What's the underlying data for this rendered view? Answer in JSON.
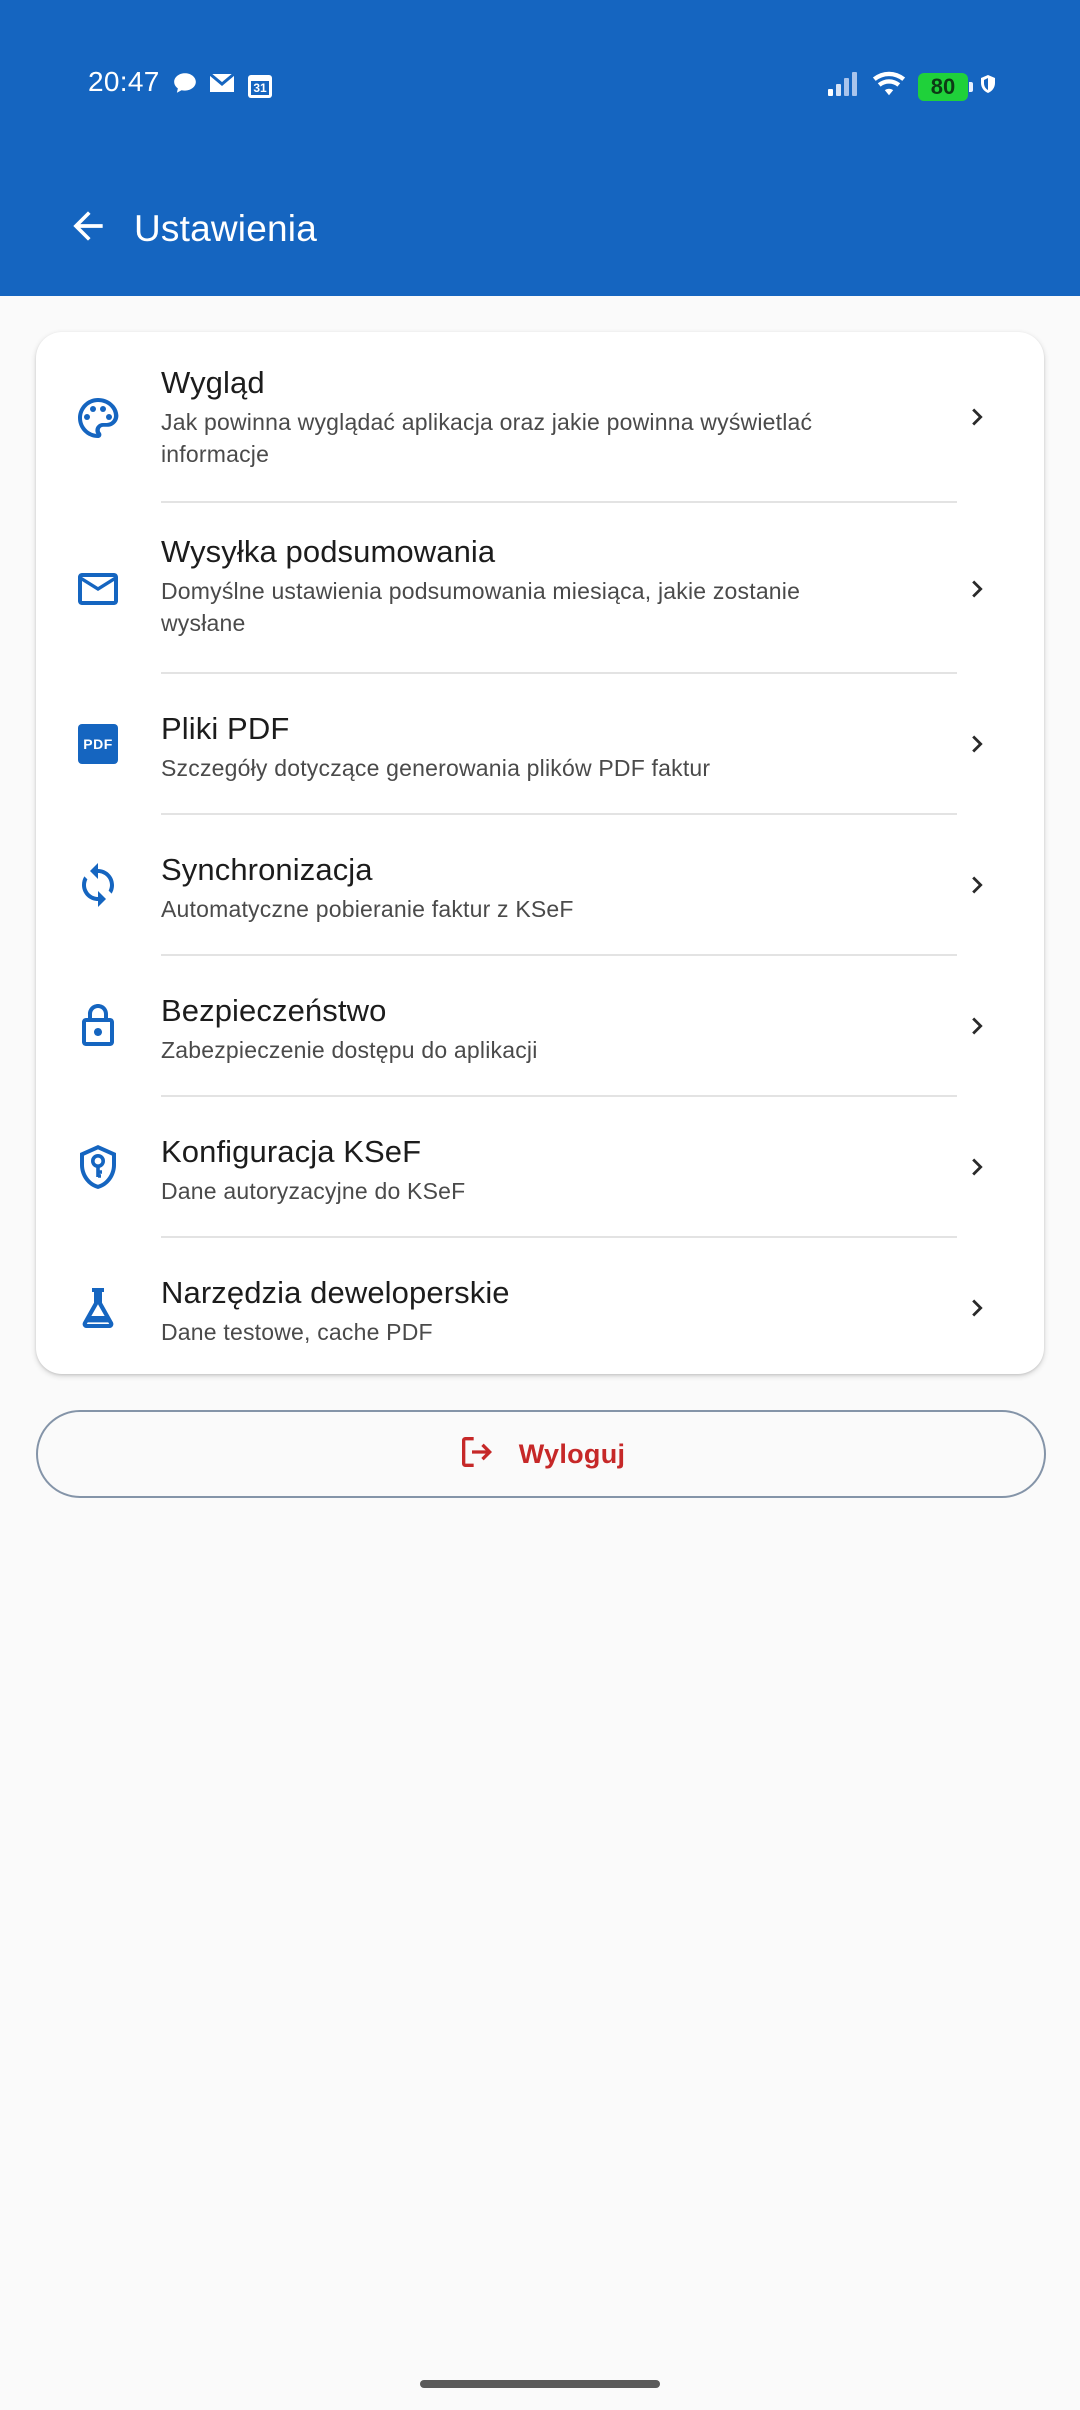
{
  "status_bar": {
    "time": "20:47",
    "battery": "80",
    "left_icons": [
      "chat-bubble-icon",
      "mail-icon",
      "calendar-icon"
    ],
    "calendar_day": "31",
    "right_icons": [
      "signal-icon",
      "wifi-icon",
      "battery-icon",
      "vpn-shield-icon"
    ]
  },
  "header": {
    "title": "Ustawienia",
    "back_icon": "arrow-back-icon"
  },
  "settings": {
    "items": [
      {
        "title": "Wygląd",
        "subtitle": "Jak powinna wyglądać aplikacja oraz jakie powinna wyświetlać informacje",
        "icon": "palette-icon"
      },
      {
        "title": "Wysyłka podsumowania",
        "subtitle": "Domyślne ustawienia podsumowania miesiąca, jakie zostanie wysłane",
        "icon": "mail-icon"
      },
      {
        "title": "Pliki PDF",
        "subtitle": "Szczegóły dotyczące generowania plików PDF faktur",
        "icon": "pdf-icon",
        "icon_text": "PDF"
      },
      {
        "title": "Synchronizacja",
        "subtitle": "Automatyczne pobieranie faktur z KSeF",
        "icon": "sync-icon"
      },
      {
        "title": "Bezpieczeństwo",
        "subtitle": "Zabezpieczenie dostępu do aplikacji",
        "icon": "lock-icon"
      },
      {
        "title": "Konfiguracja KSeF",
        "subtitle": "Dane autoryzacyjne do KSeF",
        "icon": "shield-key-icon"
      },
      {
        "title": "Narzędzia deweloperskie",
        "subtitle": "Dane testowe, cache PDF",
        "icon": "flask-icon"
      }
    ]
  },
  "logout": {
    "label": "Wyloguj",
    "icon": "logout-icon"
  },
  "colors": {
    "primary": "#1565c0",
    "background": "#fafafa",
    "card": "#ffffff",
    "danger": "#c62828",
    "icon": "#1565c0"
  }
}
